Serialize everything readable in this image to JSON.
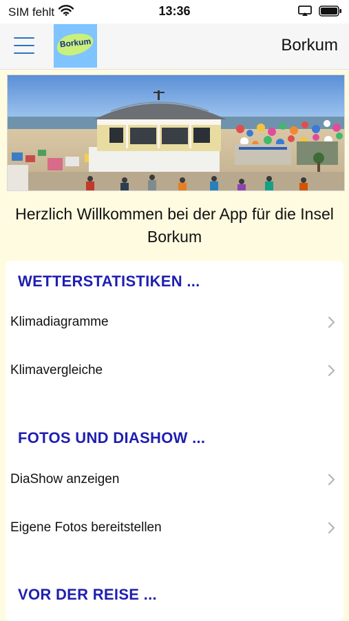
{
  "status": {
    "carrier": "SIM fehlt",
    "time": "13:36"
  },
  "navbar": {
    "title": "Borkum",
    "logo_text": "Borkum"
  },
  "welcome_text": "Herzlich Willkommen bei der App für die Insel Borkum",
  "sections": [
    {
      "header": "WETTERSTATISTIKEN ...",
      "items": [
        "Klimadiagramme",
        "Klimavergleiche"
      ]
    },
    {
      "header": "FOTOS UND DIASHOW ...",
      "items": [
        "DiaShow anzeigen",
        "Eigene Fotos bereitstellen"
      ]
    },
    {
      "header": "VOR DER REISE ...",
      "items": []
    }
  ],
  "colors": {
    "section_header": "#1f1fb0",
    "hamburger": "#2b74c7",
    "page_background": "#fefbe0"
  }
}
